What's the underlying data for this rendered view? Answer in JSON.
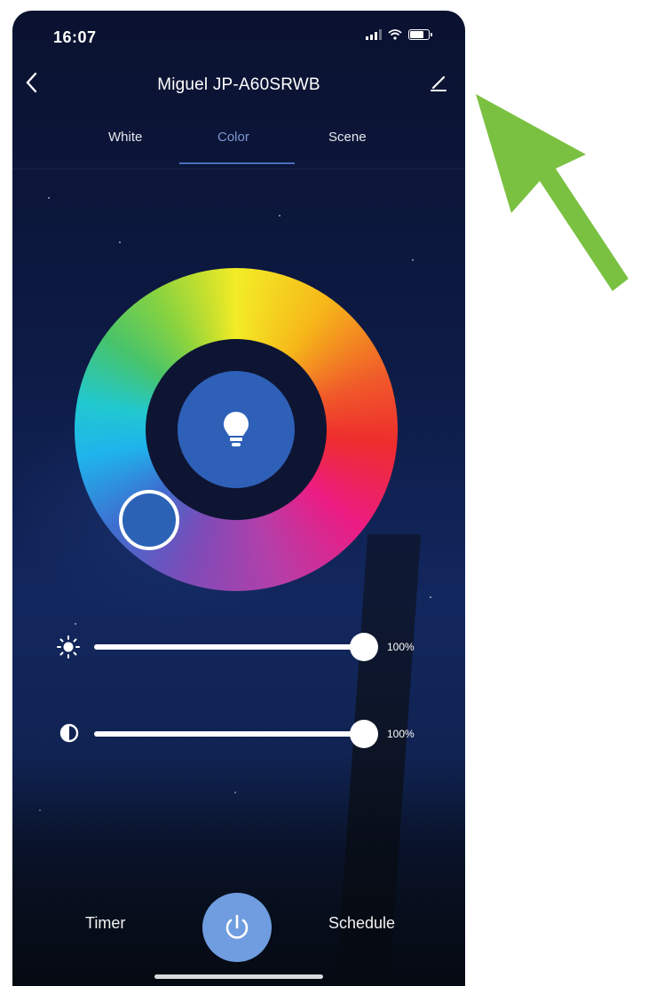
{
  "status_bar": {
    "time": "16:07"
  },
  "header": {
    "title": "Miguel JP-A60SRWB"
  },
  "tabs": [
    {
      "label": "White"
    },
    {
      "label": "Color",
      "active": true
    },
    {
      "label": "Scene"
    }
  ],
  "sliders": {
    "brightness": {
      "value": 100,
      "display": "100%",
      "icon": "sun-icon"
    },
    "contrast": {
      "value": 100,
      "display": "100%",
      "icon": "half-circle-icon"
    }
  },
  "bottom_bar": {
    "timer_label": "Timer",
    "schedule_label": "Schedule"
  },
  "colors": {
    "active_tab": "#7d97cf",
    "selected_color": "#2c62b6",
    "power_button": "#6f9de0",
    "annotation_arrow": "#7ac142"
  }
}
